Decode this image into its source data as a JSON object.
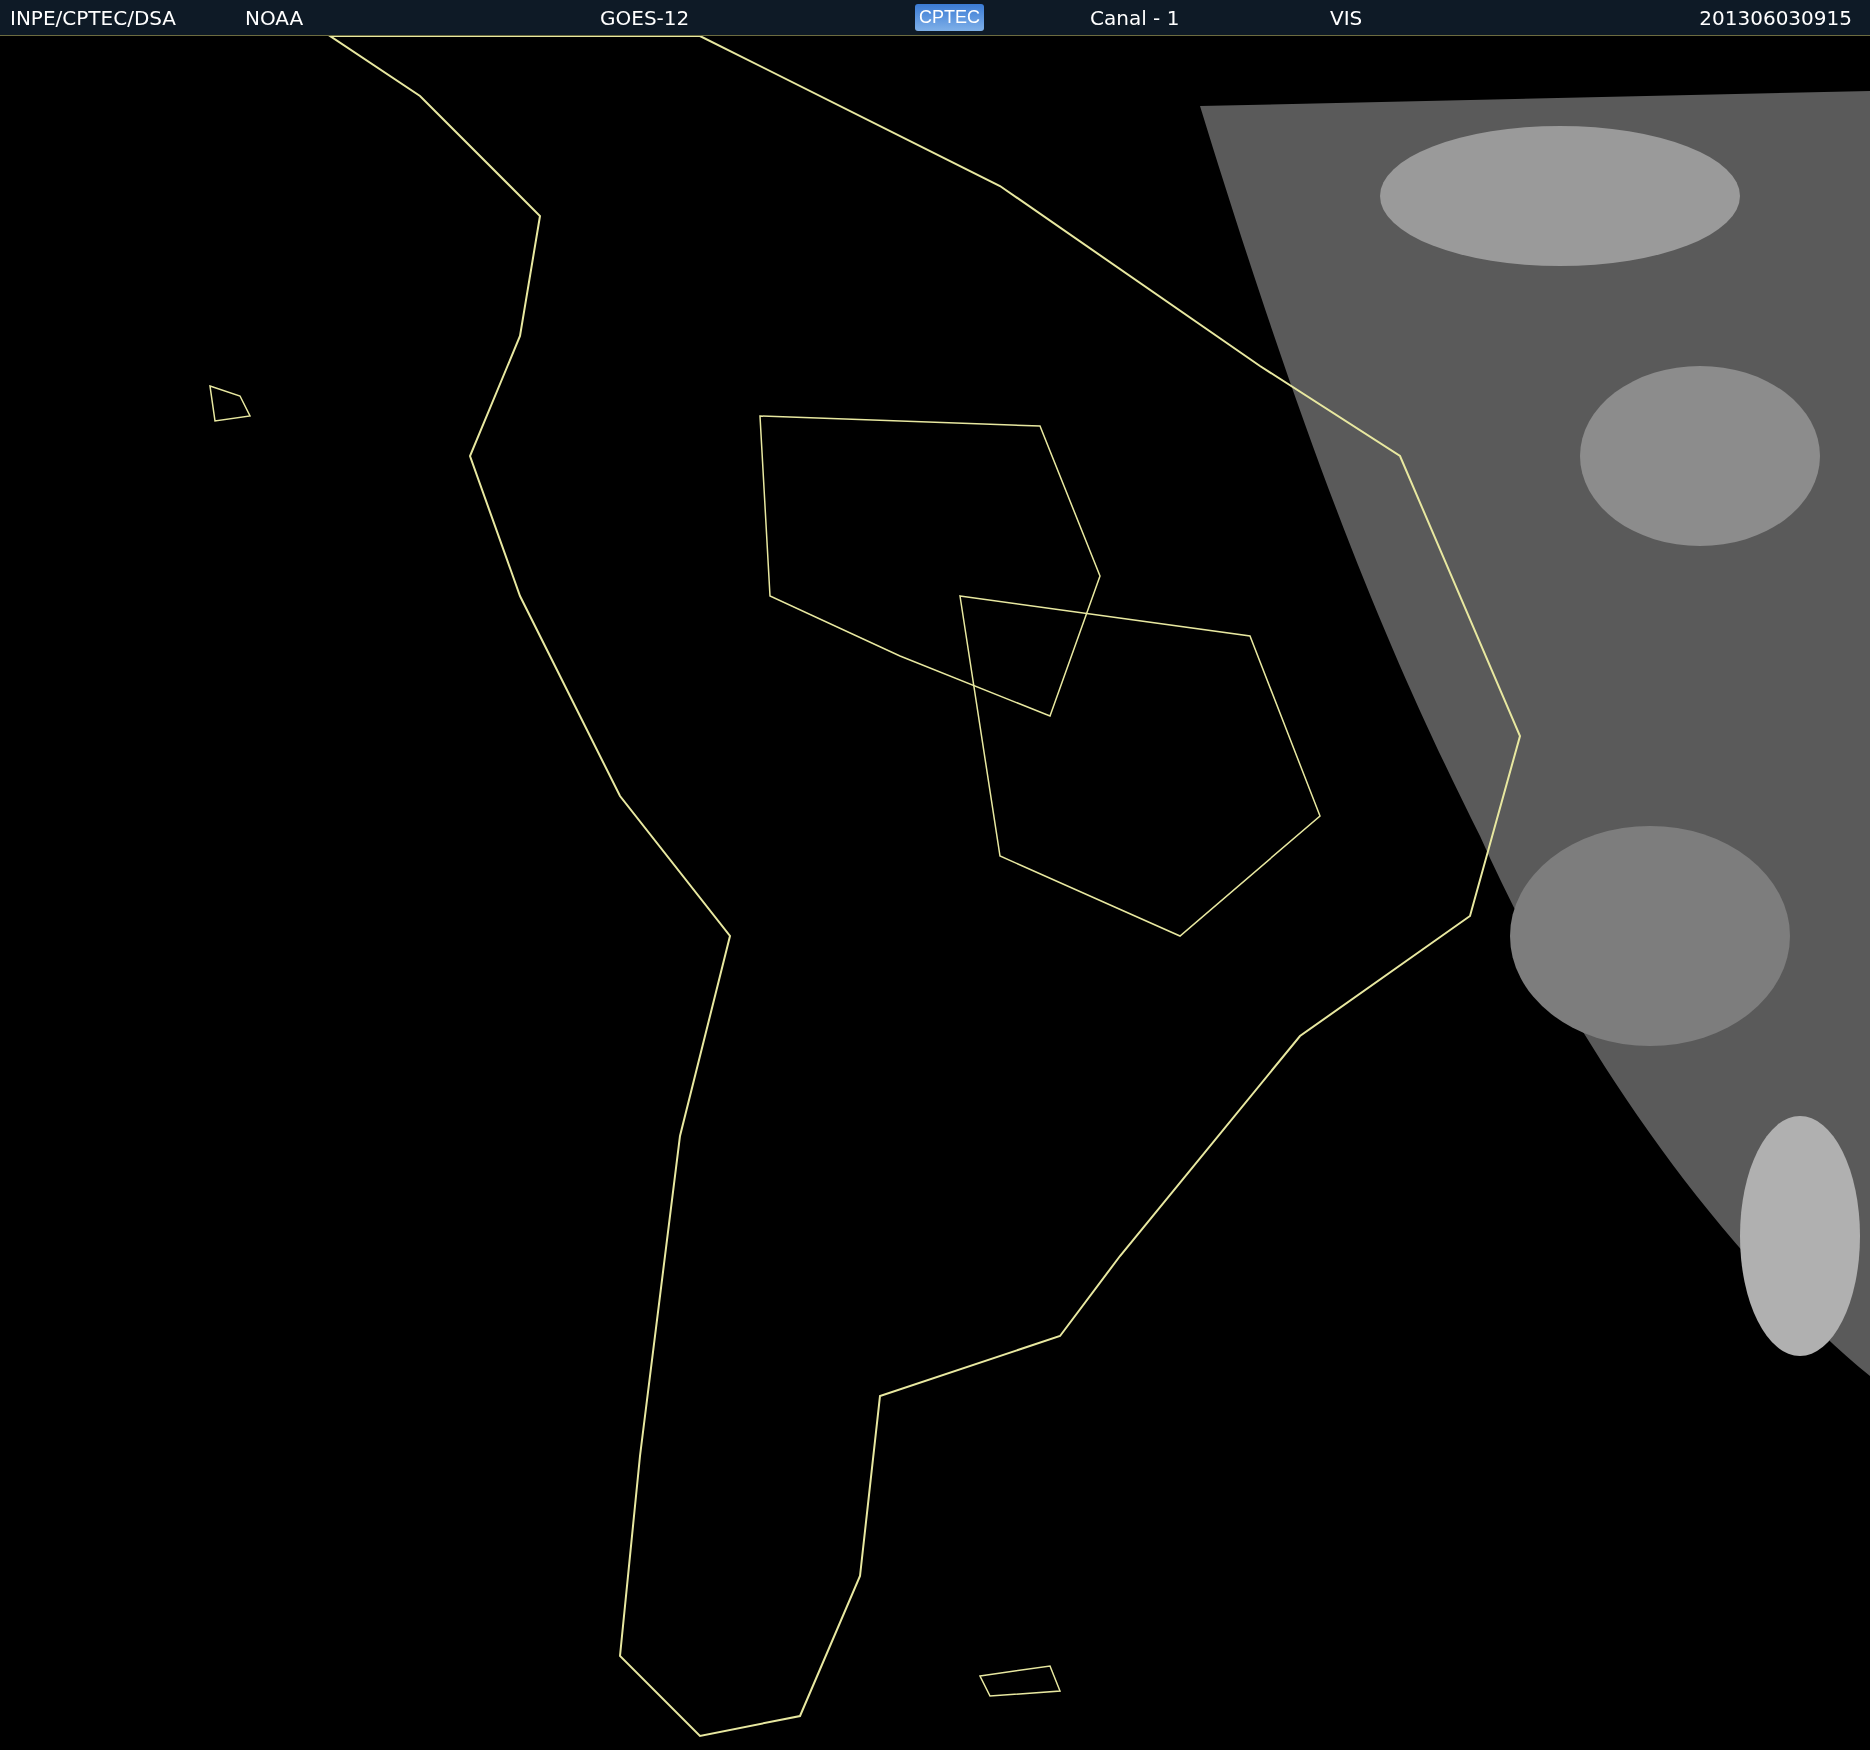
{
  "header": {
    "items": [
      {
        "kind": "text",
        "text": "INPE/CPTEC/DSA"
      },
      {
        "kind": "text",
        "text": "NOAA"
      },
      {
        "kind": "text",
        "text": "GOES-12"
      },
      {
        "kind": "logo",
        "text": "CPTEC"
      },
      {
        "kind": "text",
        "text": "Canal - 1"
      },
      {
        "kind": "text",
        "text": "VIS"
      },
      {
        "kind": "text",
        "text": "201306030915"
      }
    ]
  }
}
